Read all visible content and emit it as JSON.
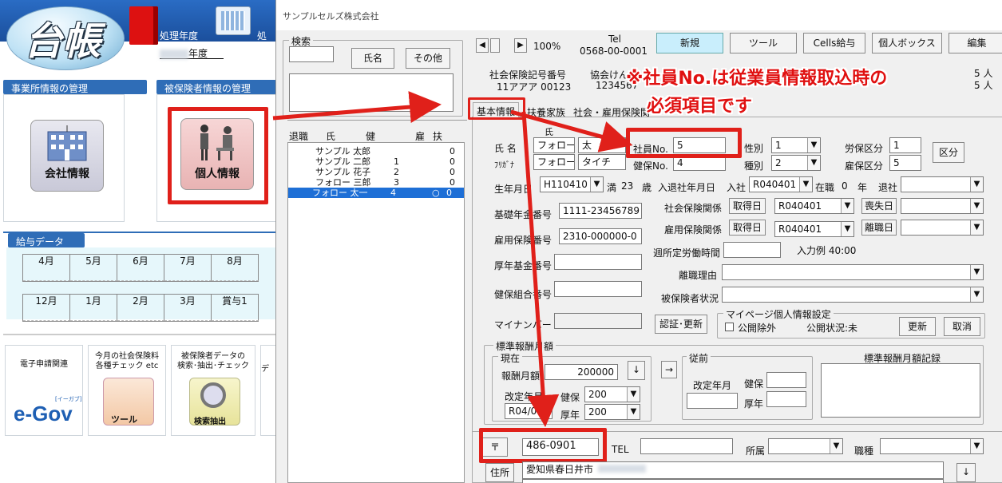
{
  "left_panel": {
    "logo": "台帳",
    "fiscal_year_label": "処理年度",
    "fiscal_year_label2": "処理",
    "fiscal_year_suffix": "年度",
    "office_section": "事業所情報の管理",
    "insured_section": "被保険者情報の管理",
    "company_info": "会社情報",
    "personal_info": "個人情報",
    "salary_section": "給与データ",
    "months_row1": [
      "4月",
      "5月",
      "6月",
      "7月",
      "8月"
    ],
    "months_row2": [
      "12月",
      "1月",
      "2月",
      "3月",
      "賞与1"
    ],
    "tools": [
      {
        "label": "電子申請関連",
        "icon_text": "e-Gov",
        "icon_sub": "[イーガブ]"
      },
      {
        "label": "今月の社会保険料\n各種チェック etc",
        "icon_text": "ツール"
      },
      {
        "label": "被保険者データの\n検索･抽出･チェック",
        "icon_text": "検索抽出"
      },
      {
        "label": "デ"
      }
    ]
  },
  "dialog": {
    "title": "サンプルセルズ株式会社",
    "search": {
      "legend": "検索",
      "name_btn": "氏名",
      "other_btn": "その他"
    },
    "list": {
      "headers": [
        "退職",
        "氏名",
        "健保No",
        "雇",
        "扶"
      ],
      "rows": [
        {
          "name": "サンプル 太郎",
          "no": "",
          "koyo": "",
          "fu": "0"
        },
        {
          "name": "サンプル 二郎",
          "no": "1",
          "koyo": "",
          "fu": "0"
        },
        {
          "name": "サンプル 花子",
          "no": "2",
          "koyo": "",
          "fu": "0"
        },
        {
          "name": "フォロー 三郎",
          "no": "3",
          "koyo": "",
          "fu": "0"
        },
        {
          "name": "フォロー 太一",
          "no": "4",
          "koyo": "○",
          "fu": "0"
        }
      ]
    },
    "toolbar": {
      "zoom": "100%",
      "tel_label": "Tel",
      "tel": "0568-00-0001",
      "new": "新規",
      "tool": "ツール",
      "cells": "Cells給与",
      "personal_box": "個人ボックス",
      "edit": "編集"
    },
    "header_info": {
      "code_label": "社会保険記号番号",
      "code": "11アアア 00123",
      "kyokai_label": "協会けんぽ",
      "kyokai_no": "1234567",
      "right1": "5 人",
      "right2": "5 人"
    },
    "annotation": {
      "line1": "※社員No.は従業員情報取込時の",
      "line2": "必須項目です"
    },
    "tabs": [
      "基本情報",
      "扶養家族",
      "社会・雇用保険関"
    ],
    "form": {
      "furigana_head": "氏",
      "name_label": "氏 名",
      "last_name": "フォロー",
      "first_name": "太",
      "kana_label": "ﾌﾘｶﾞﾅ",
      "last_kana": "フォロー",
      "first_kana": "タイチ",
      "emp_no_label": "社員No.",
      "emp_no": "5",
      "kenpo_label": "健保No.",
      "kenpo_no": "4",
      "gender_label": "性別",
      "gender": "1",
      "kind_label": "種別",
      "kind": "2",
      "rouho_label": "労保区分",
      "rouho": "1",
      "koyo_label": "雇保区分",
      "koyo": "5",
      "kubun_btn": "区分",
      "birth_label": "生年月日",
      "birth": "H110410",
      "age_prefix": "満",
      "age": "23",
      "age_unit": "歳",
      "join_label": "入退社年月日",
      "join_prefix": "入社",
      "join": "R040401",
      "tenure_prefix": "在職",
      "tenure": "0",
      "tenure_unit": "年",
      "leave_label": "退社",
      "pension_label": "基礎年金番号",
      "pension": "1111-23456789",
      "social_label": "社会保険関係",
      "acquire_btn": "取得日",
      "acquire_date": "R040401",
      "lose_btn": "喪失日",
      "emp_ins_label": "雇用保険番号",
      "emp_ins": "2310-000000-0",
      "emp_rel_label": "雇用保険関係",
      "emp_acq_btn": "取得日",
      "emp_acq_date": "R040401",
      "leave_btn": "離職日",
      "weekly_label": "週所定労働時間",
      "example_label": "入力例 40:00",
      "fund_label": "厚年基金番号",
      "reason_label": "離職理由",
      "union_label": "健保組合番号",
      "status_label": "被保険者状況",
      "mynumber_label": "マイナンバー",
      "auth_btn": "認証･更新",
      "mp_legend": "マイページ個人情報設定",
      "mp_exclude": "公開除外",
      "mp_status": "公開状況:未",
      "mp_update": "更新",
      "mp_cancel": "取消",
      "std_legend": "標準報酬月額",
      "current_legend": "現在",
      "monthly_label": "報酬月額",
      "monthly": "200000",
      "revise_label": "改定年月",
      "revise": "R04/0",
      "health_label": "健保",
      "health": "200",
      "welfare_label": "厚年",
      "welfare": "200",
      "prev_legend": "従前",
      "prev_revise": "改定年月",
      "prev_health": "健保",
      "prev_welfare": "厚年",
      "record_label": "標準報酬月額記録",
      "zip_label": "〒",
      "zip": "486-0901",
      "tel_label": "TEL",
      "dept_label": "所属",
      "job_label": "職種",
      "address_btn": "住所",
      "address": "愛知県春日井市"
    }
  }
}
